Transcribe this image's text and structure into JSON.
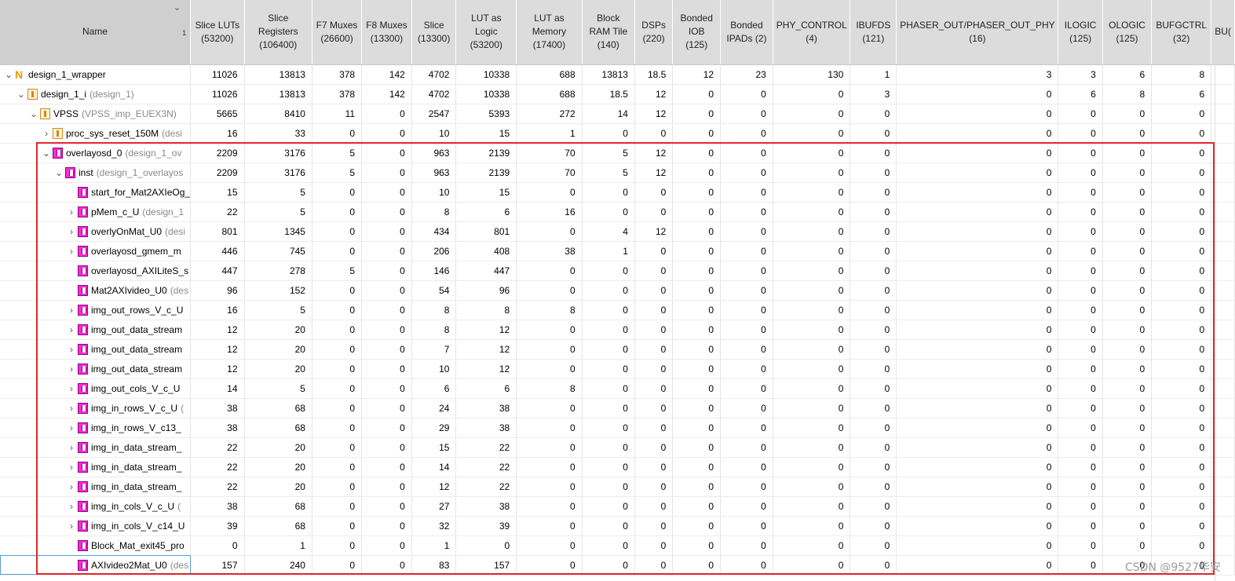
{
  "header": {
    "name": "Name",
    "sort_index": "1",
    "columns": [
      "Slice LUTs (53200)",
      "Slice Registers (106400)",
      "F7 Muxes (26600)",
      "F8 Muxes (13300)",
      "Slice (13300)",
      "LUT as Logic (53200)",
      "LUT as Memory (17400)",
      "Block RAM Tile (140)",
      "DSPs (220)",
      "Bonded IOB (125)",
      "Bonded IPADs (2)",
      "PHY_CONTROL (4)",
      "IBUFDS (121)",
      "PHASER_OUT/PHASER_OUT_PHY (16)",
      "ILOGIC (125)",
      "OLOGIC (125)",
      "BUFGCTRL (32)",
      "BU("
    ]
  },
  "rows": [
    {
      "indent": 0,
      "chev": "down",
      "icon": "top",
      "name": "design_1_wrapper",
      "def": "",
      "vals": [
        "11026",
        "13813",
        "378",
        "142",
        "4702",
        "10338",
        "688",
        "13813",
        "18.5",
        "12",
        "23",
        "130",
        "1",
        "3",
        "3",
        "6",
        "8",
        ""
      ]
    },
    {
      "indent": 1,
      "chev": "down",
      "icon": "orange",
      "name": "design_1_i",
      "def": "(design_1)",
      "vals": [
        "11026",
        "13813",
        "378",
        "142",
        "4702",
        "10338",
        "688",
        "18.5",
        "12",
        "0",
        "0",
        "0",
        "3",
        "0",
        "6",
        "8",
        "6",
        ""
      ]
    },
    {
      "indent": 2,
      "chev": "down",
      "icon": "orange",
      "name": "VPSS",
      "def": "(VPSS_imp_EUEX3N)",
      "vals": [
        "5665",
        "8410",
        "11",
        "0",
        "2547",
        "5393",
        "272",
        "14",
        "12",
        "0",
        "0",
        "0",
        "0",
        "0",
        "0",
        "0",
        "0",
        ""
      ]
    },
    {
      "indent": 3,
      "chev": "right",
      "icon": "orange",
      "name": "proc_sys_reset_150M",
      "def": "(desi",
      "vals": [
        "16",
        "33",
        "0",
        "0",
        "10",
        "15",
        "1",
        "0",
        "0",
        "0",
        "0",
        "0",
        "0",
        "0",
        "0",
        "0",
        "0",
        ""
      ]
    },
    {
      "indent": 3,
      "chev": "down",
      "icon": "pink",
      "name": "overlayosd_0",
      "def": "(design_1_ov",
      "vals": [
        "2209",
        "3176",
        "5",
        "0",
        "963",
        "2139",
        "70",
        "5",
        "12",
        "0",
        "0",
        "0",
        "0",
        "0",
        "0",
        "0",
        "0",
        ""
      ]
    },
    {
      "indent": 4,
      "chev": "down",
      "icon": "pink",
      "name": "inst",
      "def": "(design_1_overlayos",
      "vals": [
        "2209",
        "3176",
        "5",
        "0",
        "963",
        "2139",
        "70",
        "5",
        "12",
        "0",
        "0",
        "0",
        "0",
        "0",
        "0",
        "0",
        "0",
        ""
      ]
    },
    {
      "indent": 5,
      "chev": "none",
      "icon": "pink",
      "name": "start_for_Mat2AXIeOg_",
      "def": "",
      "vals": [
        "15",
        "5",
        "0",
        "0",
        "10",
        "15",
        "0",
        "0",
        "0",
        "0",
        "0",
        "0",
        "0",
        "0",
        "0",
        "0",
        "0",
        ""
      ]
    },
    {
      "indent": 5,
      "chev": "right",
      "icon": "pink",
      "name": "pMem_c_U",
      "def": "(design_1",
      "vals": [
        "22",
        "5",
        "0",
        "0",
        "8",
        "6",
        "16",
        "0",
        "0",
        "0",
        "0",
        "0",
        "0",
        "0",
        "0",
        "0",
        "0",
        ""
      ]
    },
    {
      "indent": 5,
      "chev": "right",
      "icon": "pink",
      "name": "overlyOnMat_U0",
      "def": "(desi",
      "vals": [
        "801",
        "1345",
        "0",
        "0",
        "434",
        "801",
        "0",
        "4",
        "12",
        "0",
        "0",
        "0",
        "0",
        "0",
        "0",
        "0",
        "0",
        ""
      ]
    },
    {
      "indent": 5,
      "chev": "right",
      "icon": "pink",
      "name": "overlayosd_gmem_m",
      "def": "",
      "vals": [
        "446",
        "745",
        "0",
        "0",
        "206",
        "408",
        "38",
        "1",
        "0",
        "0",
        "0",
        "0",
        "0",
        "0",
        "0",
        "0",
        "0",
        ""
      ]
    },
    {
      "indent": 5,
      "chev": "none",
      "icon": "pink",
      "name": "overlayosd_AXILiteS_s",
      "def": "",
      "vals": [
        "447",
        "278",
        "5",
        "0",
        "146",
        "447",
        "0",
        "0",
        "0",
        "0",
        "0",
        "0",
        "0",
        "0",
        "0",
        "0",
        "0",
        ""
      ]
    },
    {
      "indent": 5,
      "chev": "none",
      "icon": "pink",
      "name": "Mat2AXIvideo_U0",
      "def": "(des",
      "vals": [
        "96",
        "152",
        "0",
        "0",
        "54",
        "96",
        "0",
        "0",
        "0",
        "0",
        "0",
        "0",
        "0",
        "0",
        "0",
        "0",
        "0",
        ""
      ]
    },
    {
      "indent": 5,
      "chev": "right",
      "icon": "pink",
      "name": "img_out_rows_V_c_U",
      "def": "",
      "vals": [
        "16",
        "5",
        "0",
        "0",
        "8",
        "8",
        "8",
        "0",
        "0",
        "0",
        "0",
        "0",
        "0",
        "0",
        "0",
        "0",
        "0",
        ""
      ]
    },
    {
      "indent": 5,
      "chev": "right",
      "icon": "pink",
      "name": "img_out_data_stream",
      "def": "",
      "vals": [
        "12",
        "20",
        "0",
        "0",
        "8",
        "12",
        "0",
        "0",
        "0",
        "0",
        "0",
        "0",
        "0",
        "0",
        "0",
        "0",
        "0",
        ""
      ]
    },
    {
      "indent": 5,
      "chev": "right",
      "icon": "pink",
      "name": "img_out_data_stream",
      "def": "",
      "vals": [
        "12",
        "20",
        "0",
        "0",
        "7",
        "12",
        "0",
        "0",
        "0",
        "0",
        "0",
        "0",
        "0",
        "0",
        "0",
        "0",
        "0",
        ""
      ]
    },
    {
      "indent": 5,
      "chev": "right",
      "icon": "pink",
      "name": "img_out_data_stream",
      "def": "",
      "vals": [
        "12",
        "20",
        "0",
        "0",
        "10",
        "12",
        "0",
        "0",
        "0",
        "0",
        "0",
        "0",
        "0",
        "0",
        "0",
        "0",
        "0",
        ""
      ]
    },
    {
      "indent": 5,
      "chev": "right",
      "icon": "pink",
      "name": "img_out_cols_V_c_U",
      "def": "",
      "vals": [
        "14",
        "5",
        "0",
        "0",
        "6",
        "6",
        "8",
        "0",
        "0",
        "0",
        "0",
        "0",
        "0",
        "0",
        "0",
        "0",
        "0",
        ""
      ]
    },
    {
      "indent": 5,
      "chev": "right",
      "icon": "pink",
      "name": "img_in_rows_V_c_U",
      "def": "(",
      "vals": [
        "38",
        "68",
        "0",
        "0",
        "24",
        "38",
        "0",
        "0",
        "0",
        "0",
        "0",
        "0",
        "0",
        "0",
        "0",
        "0",
        "0",
        ""
      ]
    },
    {
      "indent": 5,
      "chev": "right",
      "icon": "pink",
      "name": "img_in_rows_V_c13_",
      "def": "",
      "vals": [
        "38",
        "68",
        "0",
        "0",
        "29",
        "38",
        "0",
        "0",
        "0",
        "0",
        "0",
        "0",
        "0",
        "0",
        "0",
        "0",
        "0",
        ""
      ]
    },
    {
      "indent": 5,
      "chev": "right",
      "icon": "pink",
      "name": "img_in_data_stream_",
      "def": "",
      "vals": [
        "22",
        "20",
        "0",
        "0",
        "15",
        "22",
        "0",
        "0",
        "0",
        "0",
        "0",
        "0",
        "0",
        "0",
        "0",
        "0",
        "0",
        ""
      ]
    },
    {
      "indent": 5,
      "chev": "right",
      "icon": "pink",
      "name": "img_in_data_stream_",
      "def": "",
      "vals": [
        "22",
        "20",
        "0",
        "0",
        "14",
        "22",
        "0",
        "0",
        "0",
        "0",
        "0",
        "0",
        "0",
        "0",
        "0",
        "0",
        "0",
        ""
      ]
    },
    {
      "indent": 5,
      "chev": "right",
      "icon": "pink",
      "name": "img_in_data_stream_",
      "def": "",
      "vals": [
        "22",
        "20",
        "0",
        "0",
        "12",
        "22",
        "0",
        "0",
        "0",
        "0",
        "0",
        "0",
        "0",
        "0",
        "0",
        "0",
        "0",
        ""
      ]
    },
    {
      "indent": 5,
      "chev": "right",
      "icon": "pink",
      "name": "img_in_cols_V_c_U",
      "def": "(",
      "vals": [
        "38",
        "68",
        "0",
        "0",
        "27",
        "38",
        "0",
        "0",
        "0",
        "0",
        "0",
        "0",
        "0",
        "0",
        "0",
        "0",
        "0",
        ""
      ]
    },
    {
      "indent": 5,
      "chev": "right",
      "icon": "pink",
      "name": "img_in_cols_V_c14_U",
      "def": "",
      "vals": [
        "39",
        "68",
        "0",
        "0",
        "32",
        "39",
        "0",
        "0",
        "0",
        "0",
        "0",
        "0",
        "0",
        "0",
        "0",
        "0",
        "0",
        ""
      ]
    },
    {
      "indent": 5,
      "chev": "none",
      "icon": "pink",
      "name": "Block_Mat_exit45_pro",
      "def": "",
      "vals": [
        "0",
        "1",
        "0",
        "0",
        "1",
        "0",
        "0",
        "0",
        "0",
        "0",
        "0",
        "0",
        "0",
        "0",
        "0",
        "0",
        "0",
        ""
      ]
    },
    {
      "indent": 5,
      "chev": "none",
      "icon": "pink",
      "name": "AXIvideo2Mat_U0",
      "def": "(des",
      "vals": [
        "157",
        "240",
        "0",
        "0",
        "83",
        "157",
        "0",
        "0",
        "0",
        "0",
        "0",
        "0",
        "0",
        "0",
        "0",
        "0",
        "0",
        ""
      ],
      "selected": true
    }
  ],
  "watermark": "CSDN @9527华安"
}
